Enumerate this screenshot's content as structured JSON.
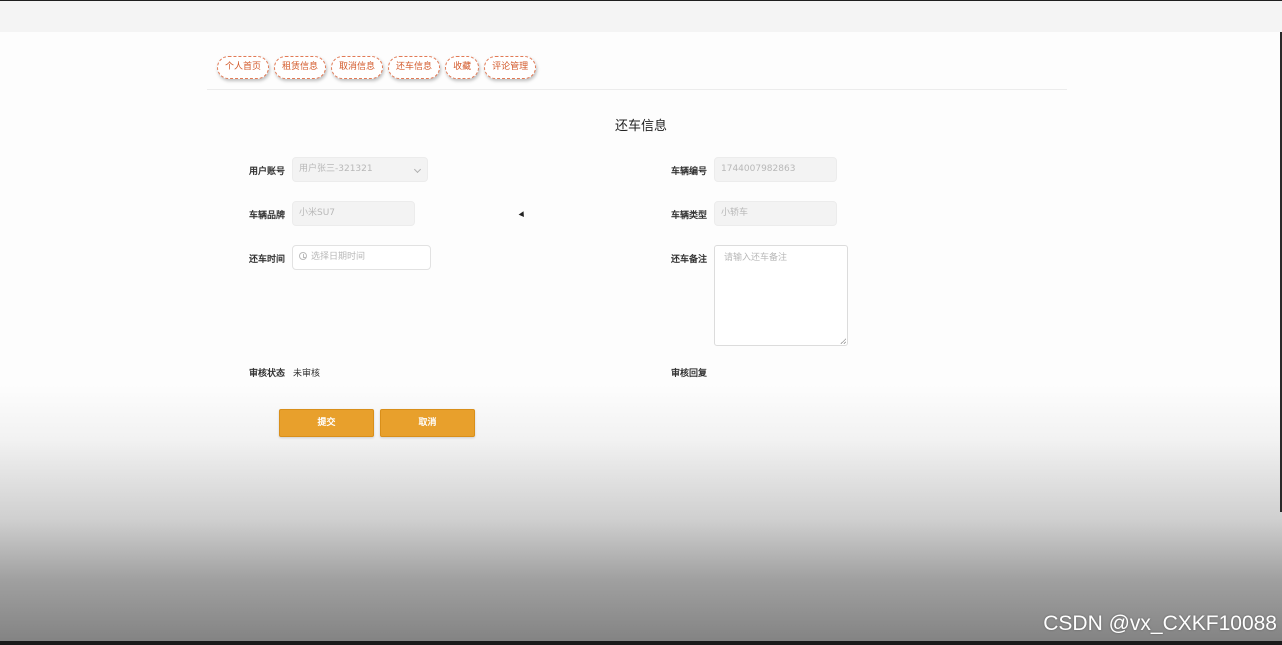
{
  "nav": {
    "tabs": [
      "个人首页",
      "租赁信息",
      "取消信息",
      "还车信息",
      "收藏",
      "评论管理"
    ]
  },
  "page": {
    "title": "还车信息"
  },
  "form": {
    "user_account": {
      "label": "用户账号",
      "value": "用户张三-321321"
    },
    "vehicle_number": {
      "label": "车辆编号",
      "value": "1744007982863"
    },
    "vehicle_brand": {
      "label": "车辆品牌",
      "value": "小米SU7"
    },
    "vehicle_type": {
      "label": "车辆类型",
      "value": "小轿车"
    },
    "return_time": {
      "label": "还车时间",
      "placeholder": "选择日期时间"
    },
    "return_note": {
      "label": "还车备注",
      "placeholder": "请输入还车备注"
    },
    "review_status": {
      "label": "审核状态",
      "value": "未审核"
    },
    "review_reply": {
      "label": "审核回复",
      "value": ""
    }
  },
  "buttons": {
    "submit": "提交",
    "cancel": "取消"
  },
  "watermark": "CSDN @vx_CXKF10088",
  "colors": {
    "accent": "#e8a02c",
    "tab_border": "#e27a55",
    "tab_text": "#d35a2b"
  }
}
